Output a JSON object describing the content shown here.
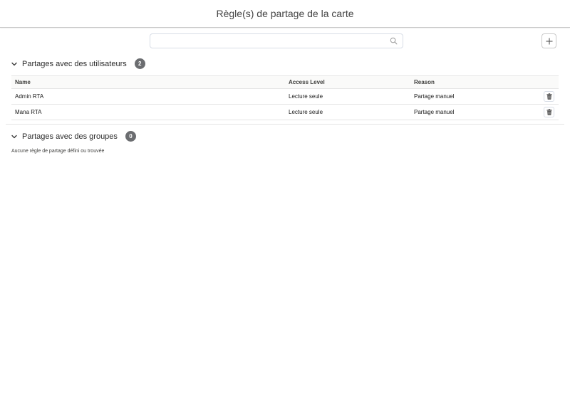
{
  "header": {
    "title": "Règle(s) de partage de la carte"
  },
  "search": {
    "value": "",
    "placeholder": "",
    "icon": "search-icon"
  },
  "toolbar": {
    "add_icon": "plus-icon"
  },
  "users_section": {
    "title": "Partages avec des utilisateurs",
    "count": "2",
    "columns": {
      "name": "Name",
      "access": "Access Level",
      "reason": "Reason"
    },
    "rows": [
      {
        "name": "Admin RTA",
        "access": "Lecture seule",
        "reason": "Partage manuel"
      },
      {
        "name": "Mana RTA",
        "access": "Lecture seule",
        "reason": "Partage manuel"
      }
    ]
  },
  "groups_section": {
    "title": "Partages avec des groupes",
    "count": "0",
    "empty_message": "Aucune règle de partage défini ou trouvée"
  },
  "colors": {
    "badge": "#6b6d70",
    "border": "#e5e5e5",
    "header_text": "#444444"
  }
}
